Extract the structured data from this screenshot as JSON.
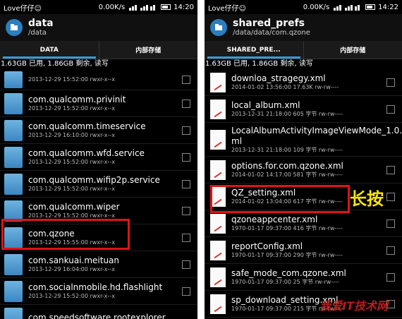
{
  "left": {
    "status": {
      "carrier": "Love仔仔☺",
      "speed": "0.00K/s",
      "time": "14:20"
    },
    "title": "data",
    "path": "/data",
    "tabs": [
      "DATA",
      "内部存储"
    ],
    "storage": "1.63GB 已用, 1.86GB 剩余, 读写",
    "items": [
      {
        "name": "",
        "meta": "2013-12-29 15:52:00   rwxr-x--x"
      },
      {
        "name": "com.qualcomm.privinit",
        "meta": "2013-12-29 15:52:00   rwxr-x--x"
      },
      {
        "name": "com.qualcomm.timeservice",
        "meta": "2013-12-29 16:10:00   rwxr-x--x"
      },
      {
        "name": "com.qualcomm.wfd.service",
        "meta": "2013-12-29 15:52:00   rwxr-x--x"
      },
      {
        "name": "com.qualcomm.wifip2p.service",
        "meta": "2013-12-29 15:52:00   rwxr-x--x"
      },
      {
        "name": "com.qualcomm.wiper",
        "meta": "2013-12-29 15:52:00   rwxr-x--x"
      },
      {
        "name": "com.qzone",
        "meta": "2013-12-29 15:55:00   rwxr-x--x"
      },
      {
        "name": "com.sankuai.meituan",
        "meta": "2013-12-29 16:04:00   rwxr-x--x"
      },
      {
        "name": "com.socialnmobile.hd.flashlight",
        "meta": "2013-12-29 15:52:00   rwxr-x--x"
      },
      {
        "name": "com.speedsoftware.rootexplorer",
        "meta": ""
      }
    ]
  },
  "right": {
    "status": {
      "carrier": "Love仔仔☺",
      "speed": "0.00K/s",
      "time": "14:22"
    },
    "title": "shared_prefs",
    "path": "/data/data/com.qzone",
    "tabs": [
      "SHARED_PRE...",
      "内部存储"
    ],
    "storage": "1.63GB 已用, 1.86GB 剩余, 读写",
    "items": [
      {
        "name": "downloa_stragegy.xml",
        "meta": "2014-01-02 13:56:00  17.63K rw-rw----"
      },
      {
        "name": "local_album.xml",
        "meta": "2013-12-31 21:18:00  605 字节  rw-rw----"
      },
      {
        "name": "LocalAlbumActivityImageViewMode_1.0.xml",
        "name_line1": "LocalAlbumActivityImageViewMode_1.0.x",
        "name_line2": "ml",
        "meta": "2013-12-31 21:18:00  109 字节  rw-rw----"
      },
      {
        "name": "options.for.com.qzone.xml",
        "meta": "2014-01-02 14:17:00  581 字节  rw-rw----"
      },
      {
        "name": "QZ_setting.xml",
        "meta": "2014-01-02 13:04:00  617 字节  rw-rw----"
      },
      {
        "name": "qzoneappcenter.xml",
        "meta": "1970-01-17 09:37:00  416 字节  rw-rw----"
      },
      {
        "name": "reportConfig.xml",
        "meta": "1970-01-17 09:37:00  290 字节  rw-rw----"
      },
      {
        "name": "safe_mode_com.qzone.xml",
        "meta": "1970-01-17 09:37:00  25 字节  rw-rw----"
      },
      {
        "name": "sp_download_setting.xml",
        "meta": "1970-01-17 09:37:00  215 字节  rw-rw----"
      }
    ],
    "annotation": "长按"
  },
  "watermark": "我爱IT技术网",
  "colors": {
    "highlight": "#e01414",
    "annotation": "#f5e60a",
    "tab_indicator": "#2fa0d8",
    "folder": "#3b86c2"
  }
}
